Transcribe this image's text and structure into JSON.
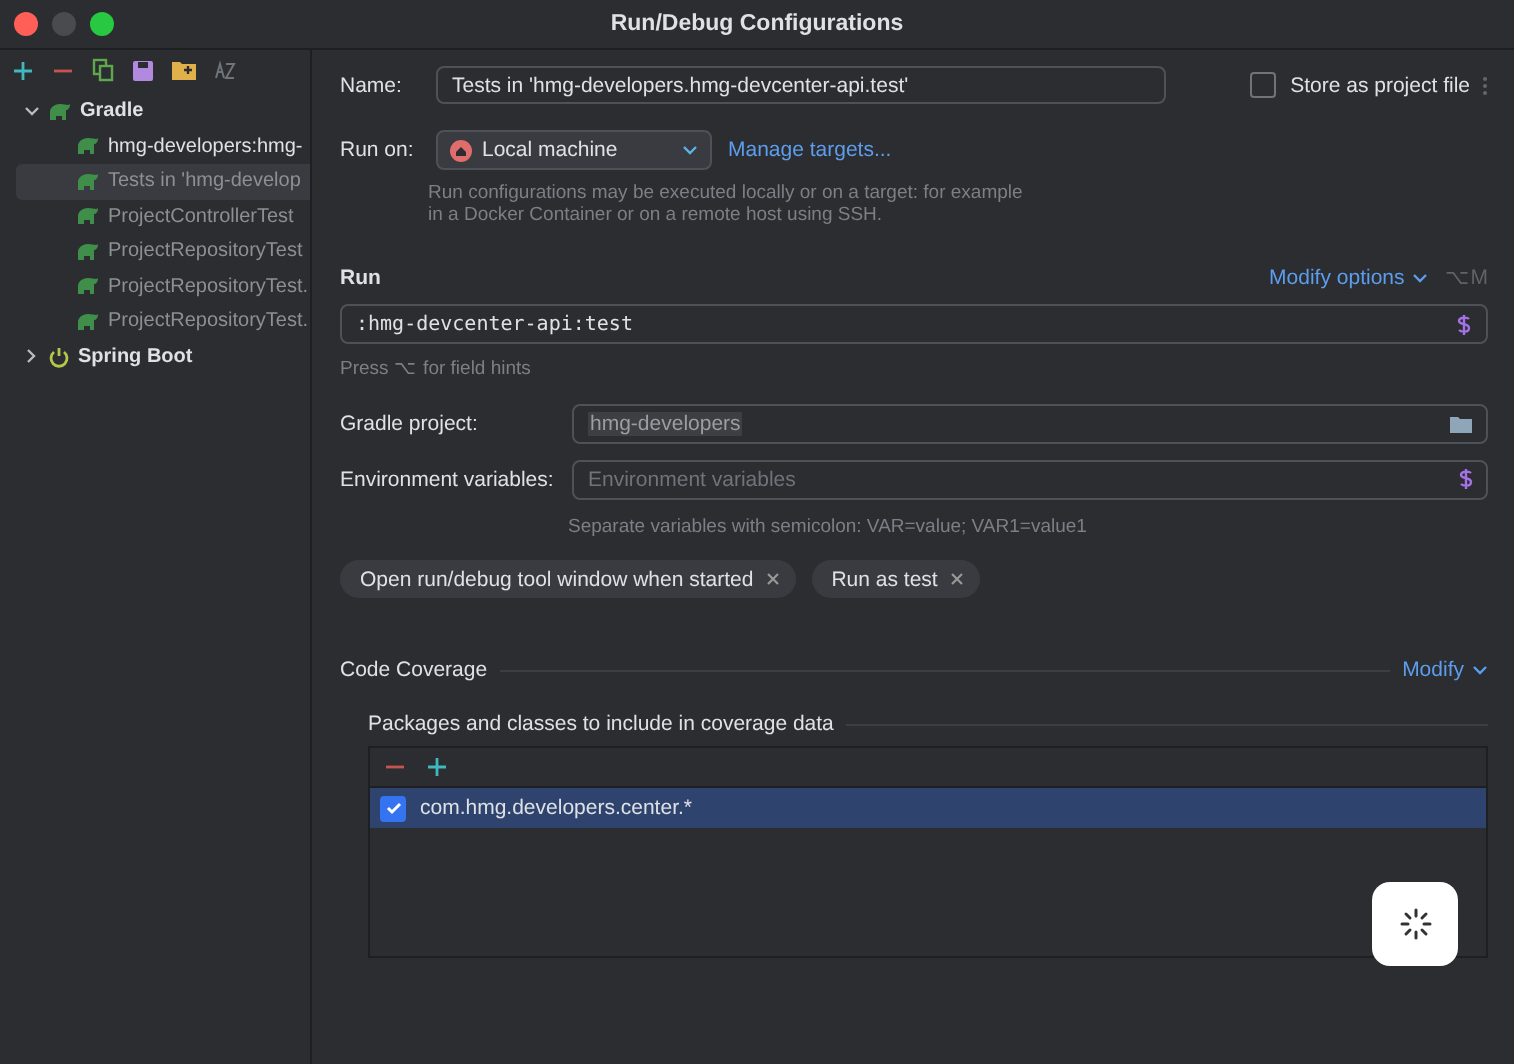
{
  "window": {
    "title": "Run/Debug Configurations"
  },
  "sidebar": {
    "toolbar": [
      {
        "kind": "add"
      },
      {
        "kind": "remove"
      },
      {
        "kind": "copy"
      },
      {
        "kind": "save"
      },
      {
        "kind": "folder"
      },
      {
        "kind": "sort"
      }
    ],
    "items": [
      {
        "label": "Gradle",
        "kind": "gradle",
        "expanded": true,
        "selected": false,
        "dimmed": false,
        "children": [
          {
            "label": "hmg-developers:hmg-",
            "kind": "gradle",
            "selected": false,
            "dimmed": false
          },
          {
            "label": "Tests in 'hmg-develop",
            "kind": "gradle",
            "selected": true,
            "dimmed": true
          },
          {
            "label": "ProjectControllerTest",
            "kind": "gradle",
            "selected": false,
            "dimmed": true
          },
          {
            "label": "ProjectRepositoryTest",
            "kind": "gradle",
            "selected": false,
            "dimmed": true
          },
          {
            "label": "ProjectRepositoryTest.",
            "kind": "gradle",
            "selected": false,
            "dimmed": true
          },
          {
            "label": "ProjectRepositoryTest.",
            "kind": "gradle",
            "selected": false,
            "dimmed": true
          }
        ]
      },
      {
        "label": "Spring Boot",
        "kind": "spring",
        "expanded": false,
        "selected": false,
        "dimmed": false
      }
    ]
  },
  "form": {
    "name": {
      "label": "Name:",
      "value": "Tests in 'hmg-developers.hmg-devcenter-api.test'"
    },
    "store_as_project_file": {
      "label": "Store as project file",
      "checked": false
    },
    "run_on": {
      "label": "Run on:",
      "value": "Local machine",
      "link": "Manage targets...",
      "hint": [
        "Run configurations may be executed locally or on a target: for example",
        "in a Docker Container or on a remote host using SSH."
      ]
    },
    "run": {
      "title": "Run",
      "modify": "Modify options",
      "shortcut": "⌥M",
      "command": ":hmg-devcenter-api:test",
      "hint": "Press ⌥ for field hints"
    },
    "gradle_project": {
      "label": "Gradle project:",
      "value": "hmg-developers"
    },
    "environment_variables": {
      "label": "Environment variables:",
      "placeholder": "Environment variables",
      "hint": "Separate variables with semicolon: VAR=value; VAR1=value1"
    },
    "chips": [
      "Open run/debug tool window when started",
      "Run as test"
    ],
    "code_coverage": {
      "title": "Code Coverage",
      "modify": "Modify",
      "packages_title": "Packages and classes to include in coverage data",
      "rows": [
        {
          "label": "com.hmg.developers.center.*",
          "checked": true,
          "selected": true
        }
      ]
    }
  }
}
